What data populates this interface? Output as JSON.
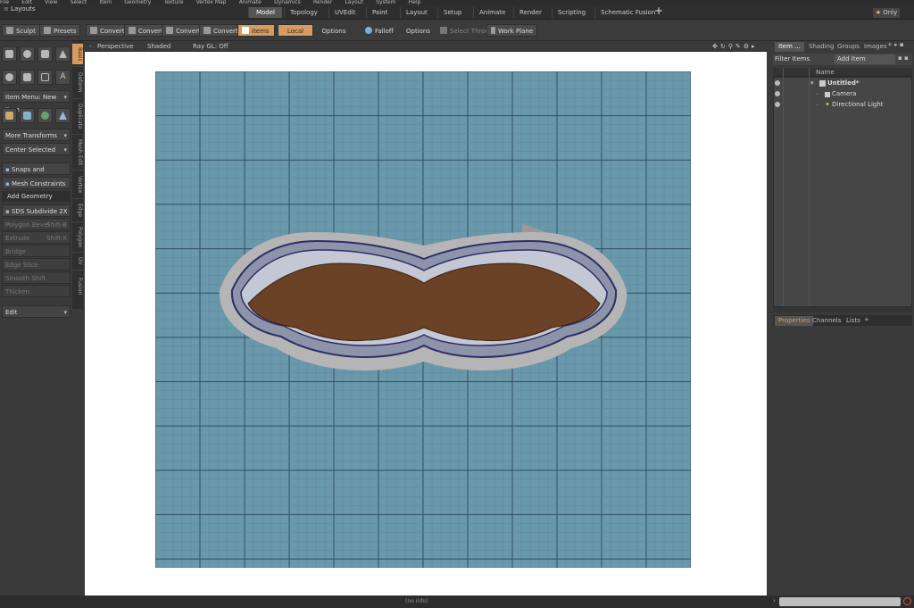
{
  "menubar": {
    "items": [
      "File",
      "Edit",
      "View",
      "Select",
      "Item",
      "Geometry",
      "Texture",
      "Vertex Map",
      "Animate",
      "Dynamics",
      "Render",
      "Layout",
      "System",
      "Help"
    ]
  },
  "layouts_label": "Layouts",
  "tabs": [
    "Model",
    "Topology",
    "UVEdit",
    "Paint",
    "Layout",
    "Setup",
    "Animate",
    "Render",
    "Scripting",
    "Schematic Fusion"
  ],
  "only_label": "Only",
  "toolbar": {
    "sculpt": "Sculpt",
    "presets": "Presets",
    "convert1": "Convert",
    "convert2": "Convert",
    "convert3": "Convert",
    "convert4": "Convert",
    "items": "Items",
    "local": "Local",
    "options1": "Options",
    "falloff": "Falloff",
    "options2": "Options",
    "select_through": "Select Through",
    "work_plane": "Work Plane"
  },
  "left": {
    "item_menu": "Item Menu: New Item",
    "more_transforms": "More Transforms",
    "center_selected": "Center Selected",
    "snaps": "Snaps and Precision",
    "mesh_constraints": "Mesh Constraints",
    "add_geometry": "Add Geometry",
    "sds_subdivide": "SDS Subdivide 2X",
    "polygon_bevel": "Polygon Bevel",
    "polygon_bevel_key": "Shift-B",
    "extrude": "Extrude",
    "extrude_key": "Shift-X",
    "bridge": "Bridge",
    "edge_slice": "Edge Slice",
    "smooth_shift": "Smooth Shift",
    "thicken": "Thicken",
    "edit": "Edit"
  },
  "vtabs": [
    "Basic",
    "Deform",
    "Duplicate",
    "Mesh Edit",
    "Vertex",
    "Edge",
    "Polygon",
    "UV",
    "Fusion"
  ],
  "viewport": {
    "perspective": "Perspective",
    "shaded": "Shaded",
    "ray_gl": "Ray GL: Off"
  },
  "right": {
    "tabs": [
      "Item ...",
      "Shading",
      "Groups",
      "Images"
    ],
    "filter": "Filter Items",
    "add_item": "Add Item",
    "col_name": "Name",
    "tree": [
      "Untitled*",
      "Camera",
      "Directional Light"
    ],
    "prop_tabs": [
      "Properties",
      "Channels",
      "Lists"
    ]
  },
  "status": {
    "info": "(no info)"
  },
  "colors": {
    "accent": "#d89b5f",
    "grid": "#6a98ab",
    "mustache": "#6b4226"
  }
}
